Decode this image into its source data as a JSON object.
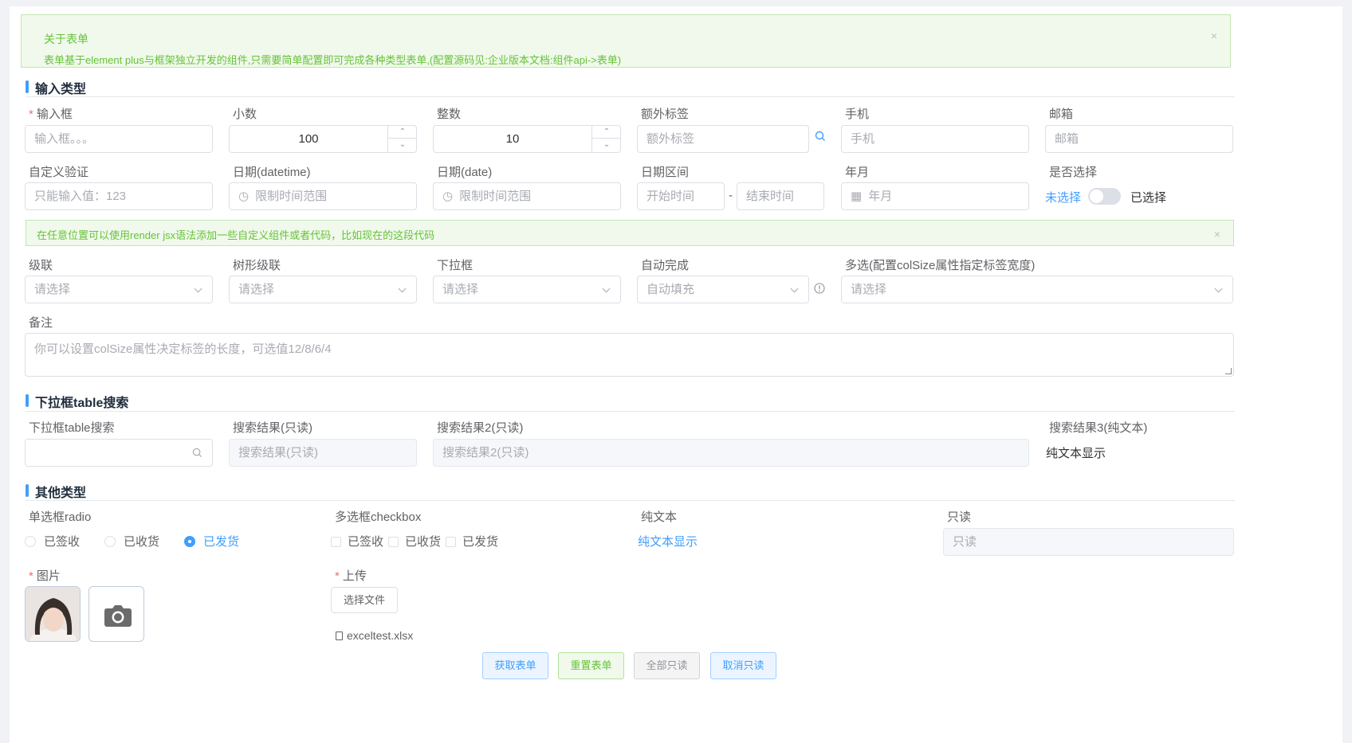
{
  "alert1": {
    "title": "关于表单",
    "desc": "表单基于element plus与框架独立开发的组件,只需要简单配置即可完成各种类型表单,(配置源码见:企业版本文档:组件api->表单)",
    "close": "×"
  },
  "sections": {
    "input": "输入类型",
    "table": "下拉框table搜索",
    "other": "其他类型"
  },
  "row1": {
    "input_label": "输入框",
    "input_placeholder": "输入框。。。",
    "decimal_label": "小数",
    "decimal_value": "100",
    "integer_label": "整数",
    "integer_value": "10",
    "extra_label": "额外标签",
    "extra_placeholder": "额外标签",
    "phone_label": "手机",
    "phone_placeholder": "手机",
    "email_label": "邮箱",
    "email_placeholder": "邮箱"
  },
  "row2": {
    "custom_label": "自定义验证",
    "custom_placeholder": "只能输入值：123",
    "datetime_label": "日期(datetime)",
    "datetime_placeholder": "限制时间范围",
    "date_label": "日期(date)",
    "date_placeholder": "限制时间范围",
    "range_label": "日期区间",
    "range_start": "开始时间",
    "range_sep": "-",
    "range_end": "结束时间",
    "month_label": "年月",
    "month_placeholder": "年月",
    "switch_label": "是否选择",
    "switch_off": "未选择",
    "switch_on": "已选择"
  },
  "alert2": {
    "text": "在任意位置可以使用render jsx语法添加一些自定义组件或者代码，比如现在的这段代码",
    "close": "×"
  },
  "row3": {
    "cascader_label": "级联",
    "cascader_placeholder": "请选择",
    "tree_label": "树形级联",
    "tree_placeholder": "请选择",
    "select_label": "下拉框",
    "select_placeholder": "请选择",
    "auto_label": "自动完成",
    "auto_placeholder": "自动填充",
    "multi_label": "多选(配置colSize属性指定标签宽度)",
    "multi_placeholder": "请选择"
  },
  "remark": {
    "label": "备注",
    "placeholder": "你可以设置colSize属性决定标签的长度，可选值12/8/6/4"
  },
  "table_row": {
    "search_label": "下拉框table搜索",
    "search_value": "",
    "result1_label": "搜索结果(只读)",
    "result1_placeholder": "搜索结果(只读)",
    "result2_label": "搜索结果2(只读)",
    "result2_placeholder": "搜索结果2(只读)",
    "result3_label": "搜索结果3(纯文本)",
    "result3_text": "纯文本显示"
  },
  "other_row": {
    "radio_label": "单选框radio",
    "radio_options": [
      "已签收",
      "已收货",
      "已发货"
    ],
    "radio_selected": "已发货",
    "checkbox_label": "多选框checkbox",
    "checkbox_options": [
      "已签收",
      "已收货",
      "已发货"
    ],
    "plain_label": "纯文本",
    "plain_text": "纯文本显示",
    "readonly_label": "只读",
    "readonly_placeholder": "只读"
  },
  "upload_row": {
    "image_label": "图片",
    "upload_label": "上传",
    "choose_file": "选择文件",
    "file_name": "exceltest.xlsx"
  },
  "buttons": {
    "get": "获取表单",
    "reset": "重置表单",
    "all_readonly": "全部只读",
    "cancel_readonly": "取消只读"
  },
  "colors": {
    "primary": "#409eff",
    "success": "#67c23a",
    "danger": "#f56c6c"
  }
}
